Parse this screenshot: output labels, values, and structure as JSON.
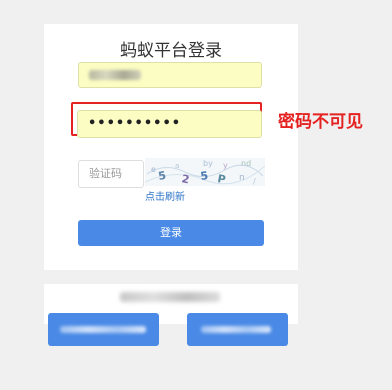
{
  "login": {
    "title": "蚂蚁平台登录",
    "password_mask": "••••••••••",
    "captcha_placeholder": "验证码",
    "refresh_label": "点击刷新",
    "login_button": "登录"
  },
  "annotation": {
    "text": "密码不可见",
    "color": "#e52222"
  },
  "colors": {
    "accent": "#4a8ae6",
    "autofill": "#fbfdc3",
    "link": "#2d74c9"
  }
}
